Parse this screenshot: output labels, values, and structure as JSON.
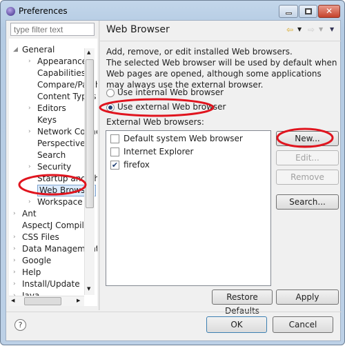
{
  "window": {
    "title": "Preferences",
    "minimize": "minimize",
    "maximize": "maximize",
    "close": "✕"
  },
  "filter": {
    "placeholder": "type filter text"
  },
  "tree": [
    {
      "label": "General",
      "level": 0,
      "expand": "expanded"
    },
    {
      "label": "Appearance",
      "level": 1,
      "expand": "collapsed"
    },
    {
      "label": "Capabilities",
      "level": 1,
      "expand": ""
    },
    {
      "label": "Compare/Patch",
      "level": 1,
      "expand": ""
    },
    {
      "label": "Content Types",
      "level": 1,
      "expand": ""
    },
    {
      "label": "Editors",
      "level": 1,
      "expand": "collapsed"
    },
    {
      "label": "Keys",
      "level": 1,
      "expand": ""
    },
    {
      "label": "Network Connections",
      "level": 1,
      "expand": "collapsed"
    },
    {
      "label": "Perspectives",
      "level": 1,
      "expand": ""
    },
    {
      "label": "Search",
      "level": 1,
      "expand": ""
    },
    {
      "label": "Security",
      "level": 1,
      "expand": "collapsed"
    },
    {
      "label": "Startup and Shutdown",
      "level": 1,
      "expand": "collapsed"
    },
    {
      "label": "Web Browser",
      "level": 1,
      "expand": "",
      "selected": true
    },
    {
      "label": "Workspace",
      "level": 1,
      "expand": "collapsed"
    },
    {
      "label": "Ant",
      "level": 0,
      "expand": "collapsed"
    },
    {
      "label": "AspectJ Compiler",
      "level": 0,
      "expand": ""
    },
    {
      "label": "CSS Files",
      "level": 0,
      "expand": "collapsed"
    },
    {
      "label": "Data Management",
      "level": 0,
      "expand": "collapsed"
    },
    {
      "label": "Google",
      "level": 0,
      "expand": "collapsed"
    },
    {
      "label": "Help",
      "level": 0,
      "expand": "collapsed"
    },
    {
      "label": "Install/Update",
      "level": 0,
      "expand": "collapsed"
    },
    {
      "label": "Java",
      "level": 0,
      "expand": "collapsed"
    }
  ],
  "page": {
    "title": "Web Browser",
    "description": "Add, remove, or edit installed Web browsers.\nThe selected Web browser will be used by default when Web pages are opened, although some applications may always use the external browser.",
    "radio_internal": "Use internal Web browser",
    "radio_external": "Use external Web browser",
    "selected_radio": "external",
    "list_label": "External Web browsers:",
    "browsers": [
      {
        "name": "Default system Web browser",
        "checked": false
      },
      {
        "name": "Internet Explorer",
        "checked": false
      },
      {
        "name": "firefox",
        "checked": true
      }
    ],
    "buttons": {
      "new": "New...",
      "edit": "Edit...",
      "remove": "Remove",
      "search": "Search..."
    },
    "restore_defaults": "Restore Defaults",
    "apply": "Apply"
  },
  "footer": {
    "ok": "OK",
    "cancel": "Cancel",
    "help": "?"
  },
  "annotation_color": "#e0141e"
}
